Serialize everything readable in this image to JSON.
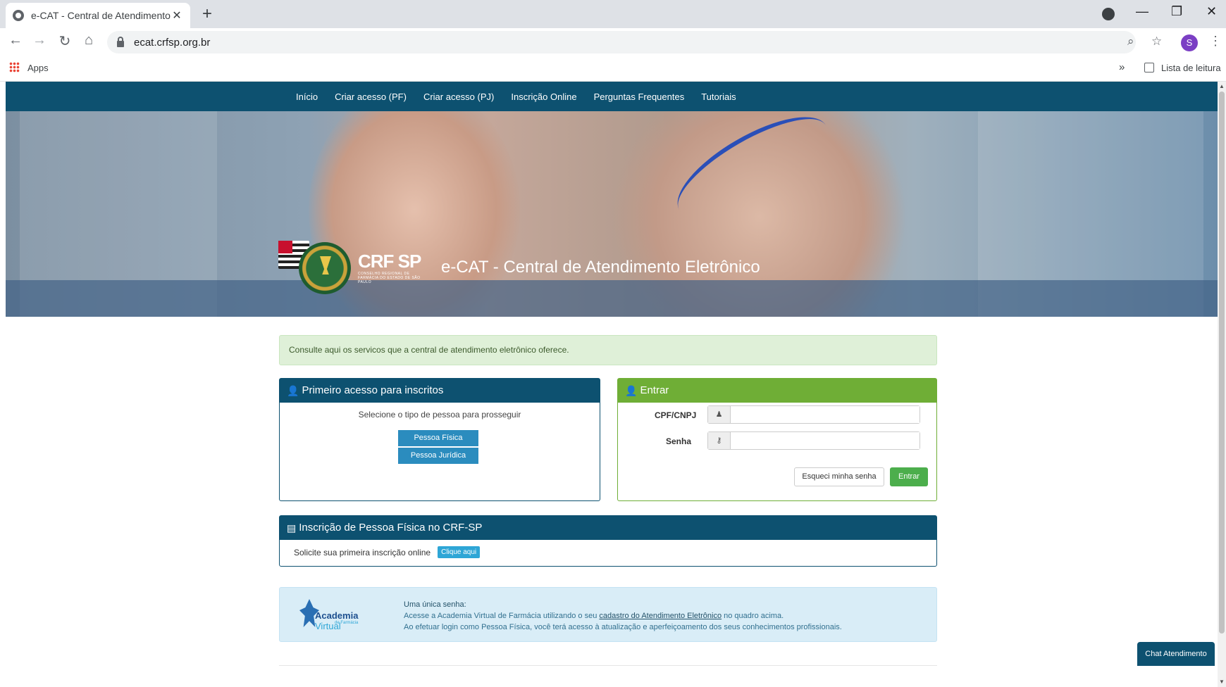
{
  "browser": {
    "tab_title": "e-CAT - Central de Atendimento",
    "url": "ecat.crfsp.org.br",
    "profile_initial": "S",
    "bookmarks": {
      "apps_label": "Apps",
      "reading_list_label": "Lista de leitura",
      "more": "»"
    }
  },
  "nav": {
    "items": [
      "Início",
      "Criar acesso (PF)",
      "Criar acesso (PJ)",
      "Inscrição Online",
      "Perguntas Frequentes",
      "Tutoriais"
    ]
  },
  "hero": {
    "logo_text": "CRF SP",
    "logo_subtitle": "CONSELHO REGIONAL DE FARMÁCIA DO ESTADO DE SÃO PAULO",
    "title": "e-CAT - Central de Atendimento Eletrônico"
  },
  "alert": {
    "text": "Consulte aqui os servicos que a central de atendimento eletrônico oferece."
  },
  "first_access": {
    "title": "Primeiro acesso para inscritos",
    "instruction": "Selecione o tipo de pessoa para prosseguir",
    "btn_pf": "Pessoa Física",
    "btn_pj": "Pessoa Jurídica"
  },
  "login": {
    "title": "Entrar",
    "cpf_label": "CPF/CNPJ",
    "cpf_value": "",
    "password_label": "Senha",
    "password_value": "",
    "forgot_label": "Esqueci minha senha",
    "submit_label": "Entrar"
  },
  "registration": {
    "title": "Inscrição de Pessoa Física no CRF-SP",
    "text": "Solicite sua primeira inscrição online",
    "button": "Clique aqui"
  },
  "academy": {
    "logo_text": "Academia",
    "logo_text_2": "Virtual",
    "logo_sub": "de Farmácia",
    "heading": "Uma única senha:",
    "line1_pre": "Acesse a Academia Virtual de Farmácia utilizando o seu",
    "line1_link": "cadastro do Atendimento Eletrônico",
    "line1_post": "no quadro acima.",
    "line2": "Ao efetuar login como Pessoa Física, você terá acesso à atualização e aperfeiçoamento dos seus conhecimentos profissionais."
  },
  "chat": {
    "label": "Chat Atendimento"
  }
}
